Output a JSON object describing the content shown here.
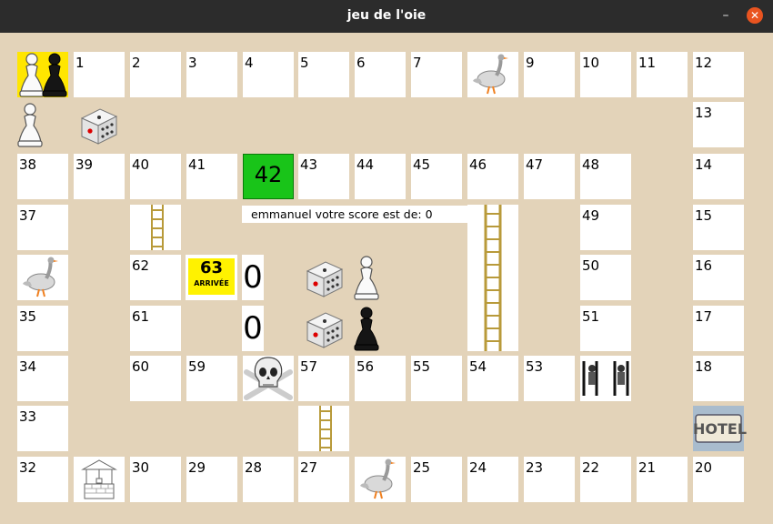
{
  "window": {
    "title": "jeu de l'oie",
    "minimize": "–",
    "close": "✕"
  },
  "board": {
    "c1": "1",
    "c2": "2",
    "c3": "3",
    "c4": "4",
    "c5": "5",
    "c6": "6",
    "c7": "7",
    "c9": "9",
    "c10": "10",
    "c11": "11",
    "c12": "12",
    "c13": "13",
    "c14": "14",
    "c15": "15",
    "c16": "16",
    "c17": "17",
    "c18": "18",
    "c20": "20",
    "c21": "21",
    "c22": "22",
    "c23": "23",
    "c24": "24",
    "c25": "25",
    "c27": "27",
    "c28": "28",
    "c29": "29",
    "c30": "30",
    "c32": "32",
    "c33": "33",
    "c34": "34",
    "c35": "35",
    "c37": "37",
    "c38": "38",
    "c39": "39",
    "c40": "40",
    "c41": "41",
    "c42": "42",
    "c43": "43",
    "c44": "44",
    "c45": "45",
    "c46": "46",
    "c47": "47",
    "c48": "48",
    "c49": "49",
    "c50": "50",
    "c51": "51",
    "c53": "53",
    "c54": "54",
    "c55": "55",
    "c56": "56",
    "c57": "57",
    "c59": "59",
    "c60": "60",
    "c61": "61",
    "c62": "62",
    "c63": "63",
    "arrivee": "ARRIVÉE",
    "hotel": "HOTEL"
  },
  "score": {
    "message": "emmanuel votre score est de: 0",
    "player1_score": "0",
    "player2_score": "0"
  },
  "icons": {
    "goose": "goose-icon",
    "ladder": "ladder-icon",
    "dice": "dice-icon",
    "pawn_white": "white-pawn-icon",
    "pawn_black": "black-pawn-icon",
    "skull": "skull-icon",
    "well": "well-icon",
    "prison": "prison-icon",
    "hotel": "hotel-icon"
  },
  "colors": {
    "background": "#e3d3b9",
    "start_cell": "#ffe600",
    "cell_42": "#19c419",
    "arrivee": "#fff200",
    "close_button": "#e95420"
  }
}
